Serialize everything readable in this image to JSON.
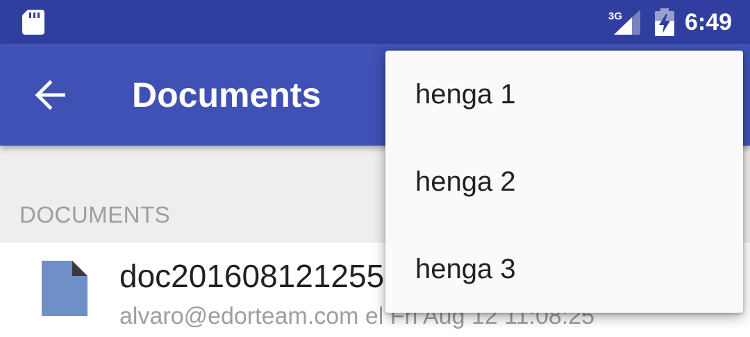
{
  "status_bar": {
    "network_type": "3G",
    "time": "6:49",
    "icons": [
      "sd-card-icon",
      "signal-icon",
      "battery-charging-icon"
    ]
  },
  "app_bar": {
    "title": "Documents",
    "back_icon": "arrow-back-icon",
    "color": "#3f51b5",
    "status_color": "#303f9f"
  },
  "section": {
    "label": "DOCUMENTS"
  },
  "list": {
    "items": [
      {
        "title": "doc201608121255",
        "subtitle": "alvaro@edorteam.com el Fri Aug 12 11:08:25",
        "icon": "document-file-icon",
        "icon_color": "#6f8fc7"
      }
    ]
  },
  "menu": {
    "items": [
      {
        "label": "henga 1"
      },
      {
        "label": "henga 2"
      },
      {
        "label": "henga 3"
      }
    ]
  }
}
